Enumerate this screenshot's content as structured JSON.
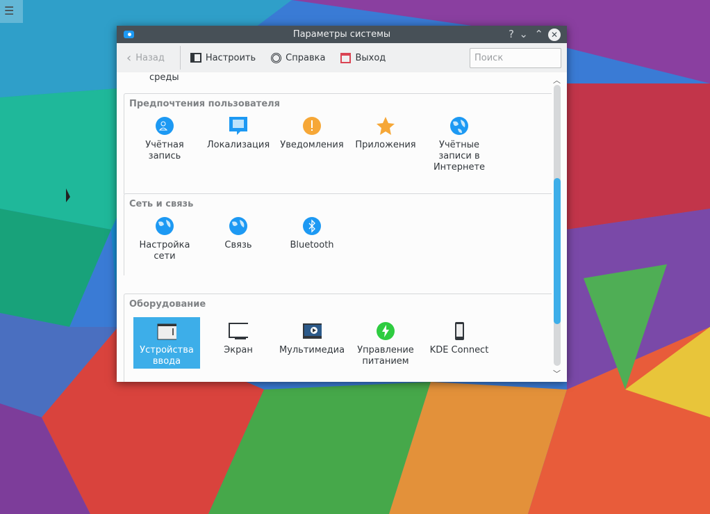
{
  "window": {
    "title": "Параметры системы",
    "help": "?",
    "minimize": "⌄",
    "maximize": "⌃",
    "close": "✕"
  },
  "toolbar": {
    "back": "Назад",
    "configure": "Настроить",
    "help": "Справка",
    "quit": "Выход",
    "search_placeholder": "Поиск"
  },
  "cut_label": "среды",
  "groups": [
    {
      "title": "Предпочтения пользователя",
      "items": [
        {
          "label": "Учётная запись"
        },
        {
          "label": "Локализация"
        },
        {
          "label": "Уведомления"
        },
        {
          "label": "Приложения"
        },
        {
          "label": "Учётные записи в Интернете"
        }
      ]
    },
    {
      "title": "Сеть и связь",
      "items": [
        {
          "label": "Настройка сети"
        },
        {
          "label": "Связь"
        },
        {
          "label": "Bluetooth"
        }
      ]
    },
    {
      "title": "Оборудование",
      "items": [
        {
          "label": "Устройства ввода"
        },
        {
          "label": "Экран"
        },
        {
          "label": "Мультимедиа"
        },
        {
          "label": "Управление питанием"
        },
        {
          "label": "KDE Connect"
        }
      ]
    }
  ],
  "colors": {
    "accent": "#3daee9",
    "titlebar": "#475057"
  }
}
